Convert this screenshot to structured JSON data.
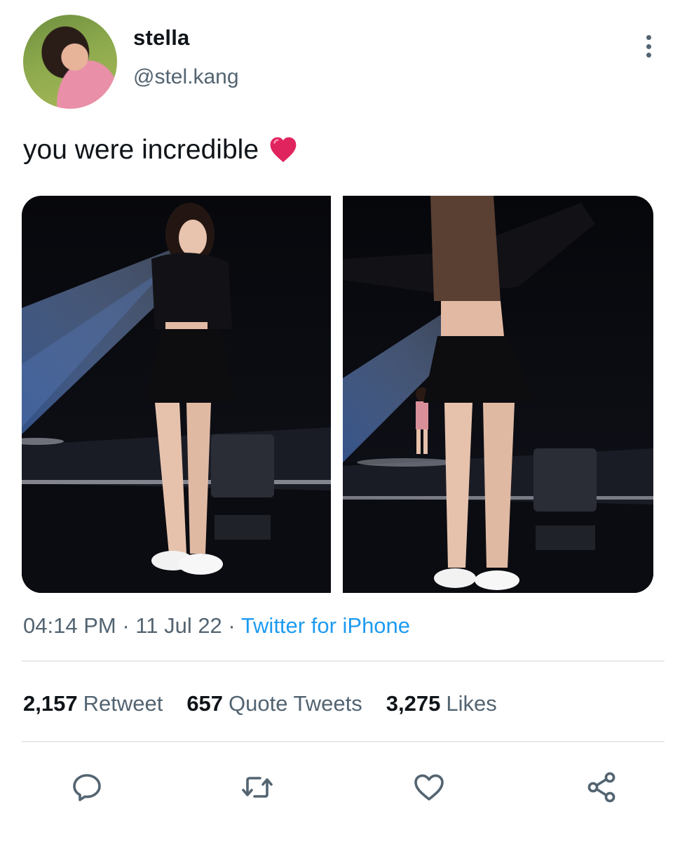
{
  "author": {
    "display_name": "stella",
    "handle": "@stel.kang"
  },
  "tweet": {
    "text": "you were incredible",
    "emoji": "heart-emoji"
  },
  "meta": {
    "time": "04:14 PM",
    "separator": "·",
    "date": "11 Jul 22",
    "source": "Twitter for iPhone"
  },
  "stats": {
    "retweets_count": "2,157",
    "retweets_label": "Retweet",
    "quotes_count": "657",
    "quotes_label": "Quote Tweets",
    "likes_count": "3,275",
    "likes_label": "Likes"
  },
  "icons": {
    "more": "more-vertical-icon",
    "reply": "reply-icon",
    "retweet": "retweet-icon",
    "like": "heart-icon",
    "share": "share-icon"
  },
  "colors": {
    "accent": "#1d9bf0",
    "secondary_text": "#536471",
    "emoji_heart": "#e0245e"
  }
}
